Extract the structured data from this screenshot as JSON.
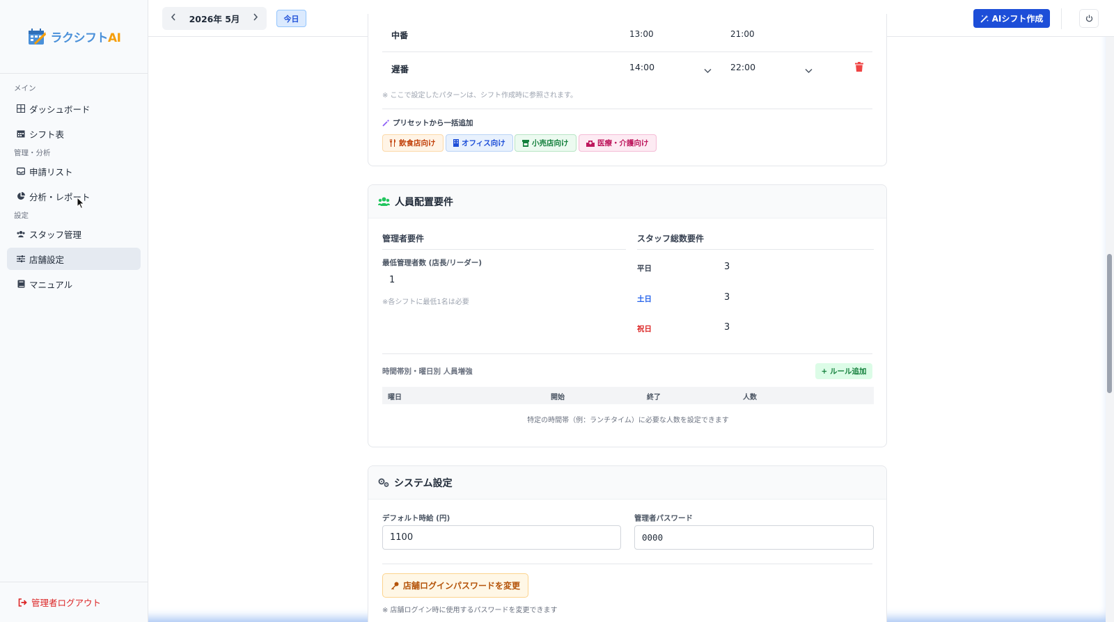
{
  "brand": {
    "name_main": "ラクシフト",
    "name_accent": "AI"
  },
  "sidebar": {
    "sections": [
      "メイン",
      "管理・分析",
      "設定"
    ],
    "items": [
      {
        "label": "ダッシュボード",
        "icon": "grid-icon"
      },
      {
        "label": "シフト表",
        "icon": "calendar-icon"
      },
      {
        "label": "申請リスト",
        "icon": "inbox-icon"
      },
      {
        "label": "分析・レポート",
        "icon": "pie-chart-icon"
      },
      {
        "label": "スタッフ管理",
        "icon": "users-icon"
      },
      {
        "label": "店舗設定",
        "icon": "sliders-icon",
        "active": true
      },
      {
        "label": "マニュアル",
        "icon": "book-icon"
      }
    ],
    "logout": "管理者ログアウト"
  },
  "topbar": {
    "month": "2026年 5月",
    "today": "今日",
    "ai_button": "AIシフト作成"
  },
  "shift_patterns": {
    "partial_row": {
      "name": "中番",
      "start": "13:00",
      "end": "21:00"
    },
    "late_row": {
      "name": "遅番",
      "start": "14:00",
      "end": "22:00"
    },
    "note": "※ ここで設定したパターンは、シフト作成時に参照されます。",
    "preset_title": "プリセットから一括追加",
    "presets": [
      "飲食店向け",
      "オフィス向け",
      "小売店向け",
      "医療・介護向け"
    ]
  },
  "staffing": {
    "title": "人員配置要件",
    "manager_header": "管理者要件",
    "staff_header": "スタッフ総数要件",
    "min_manager_label": "最低管理者数 (店長/リーダー)",
    "min_manager_value": "1",
    "min_manager_note": "※各シフトに最低1名は必要",
    "weekday_label": "平日",
    "weekday_value": "3",
    "saturday_label": "土日",
    "saturday_value": "3",
    "holiday_label": "祝日",
    "holiday_value": "3",
    "rules_title": "時間帯別・曜日別 人員増強",
    "add_rule": "+ ルール追加",
    "columns": [
      "曜日",
      "開始",
      "終了",
      "人数"
    ],
    "empty_text": "特定の時間帯（例：ランチタイム）に必要な人数を設定できます"
  },
  "system": {
    "title": "システム設定",
    "wage_label": "デフォルト時給 (円)",
    "wage_value": "1100",
    "password_label": "管理者パスワード",
    "password_value": "0000",
    "change_login_button": "店舗ログインパスワードを変更",
    "change_login_note": "※ 店舗ログイン時に使用するパスワードを変更できます"
  },
  "colors": {
    "accent": "#1d4ed8",
    "danger": "#dc2626",
    "success": "#16a34a"
  }
}
